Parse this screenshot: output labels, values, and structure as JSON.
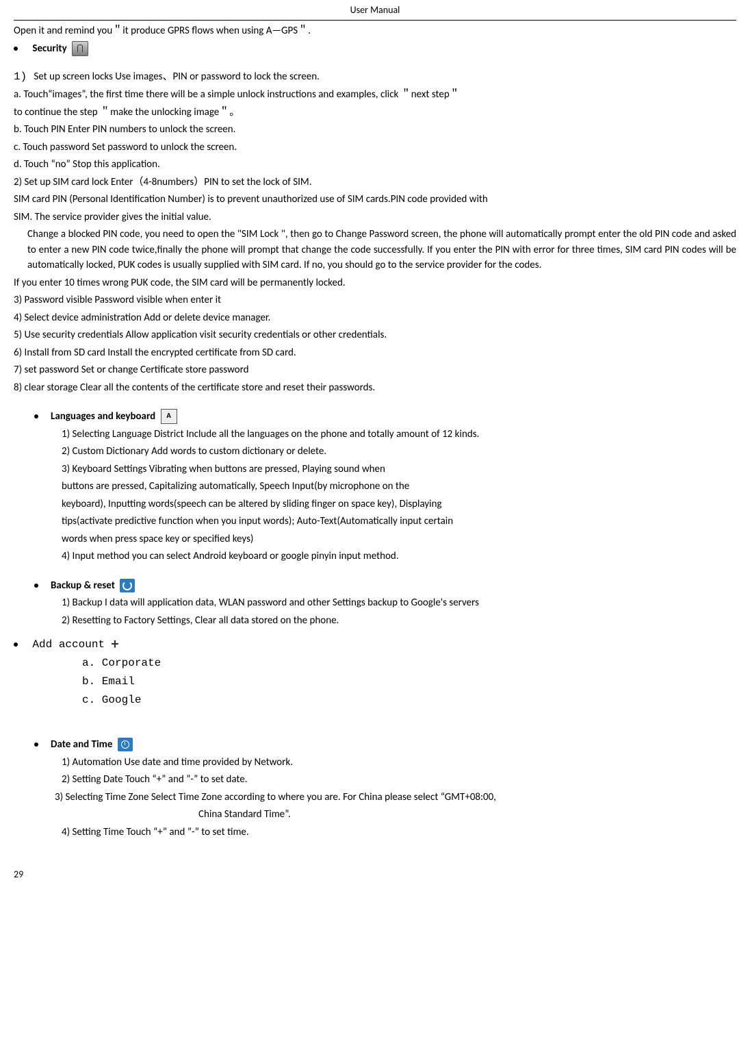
{
  "header_title": "User    Manual",
  "intro_line": "Open it and remind you＂it produce GPRS flows when using A—GPS＂.",
  "security_title": "Security",
  "security_item1_prefix": "1)",
  "security_item1": "Set up screen locks      Use images、PIN or password to lock the screen.",
  "security_a": "a. Touch“images”,    the first time there will be a simple unlock instructions and examples, click ＂next step＂",
  "security_a_cont": "to continue the step ＂make the unlocking image＂。",
  "security_b": "b. Touch PIN Enter PIN numbers to unlock the screen.",
  "security_c": "c. Touch password      Set password to unlock the screen.",
  "security_d": "d. Touch “no”      Stop this application.",
  "security_item2": "2)    Set up SIM card lock      Enter（4-8numbers）PIN to set the lock of SIM.",
  "sim_para1": "SIM card PIN (Personal Identification Number) is to prevent unauthorized use of SIM cards.PIN code provided with",
  "sim_para1b": "SIM. The service provider gives the initial value.",
  "sim_para2": "Change a blocked PIN code, you need to open the \"SIM Lock \", then go to Change Password screen, the phone will automatically prompt enter the old PIN code and asked to enter a new PIN code twice,finally the phone will prompt that change the code successfully. If you enter the PIN with error for three times, SIM card PIN codes will be automatically locked, PUK codes is usually supplied with SIM card. If no, you should go to the service provider for the codes.",
  "sim_para3": "If you enter 10 times wrong PUK code, the SIM card will be permanently locked.",
  "security_item3": "3)    Password visible        Password visible when enter it",
  "security_item4": "4)    Select device administration      Add or delete device manager.",
  "security_item5": "5)    Use security credentials        Allow application visit security credentials or other credentials.",
  "security_item6": "6)    Install from SD card      Install the encrypted certificate from SD card.",
  "security_item7": "7)    set password        Set or change Certificate store password",
  "security_item8": "8)    clear storage        Clear all the contents of the certificate store and reset their passwords.",
  "lang_title": "Languages and keyboard",
  "lang_icon_text": "A",
  "lang_1": "1) Selecting Language District        Include all the languages on the phone and totally amount of 12 kinds.",
  "lang_2": "2) Custom Dictionary          Add words to custom dictionary or delete.",
  "lang_3a": "3) Keyboard Settings        Vibrating when buttons are pressed, Playing sound when",
  "lang_3b": "buttons are pressed, Capitalizing automatically, Speech Input(by microphone on the",
  "lang_3c": "keyboard), Inputting words(speech can be altered by sliding finger on space key), Displaying",
  "lang_3d": "tips(activate predictive function when you input words); Auto-Text(Automatically input certain",
  "lang_3e": "words when press space key or specified keys)",
  "lang_4": "4) Input method        you can select Android keyboard or google pinyin input method.",
  "backup_title": "Backup & reset",
  "backup_1": "1)    Backup I  data will application data, WLAN password and other Settings backup to Google's servers",
  "backup_2": "2)    Resetting to Factory Settings, Clear all data stored on the phone.",
  "add_account_title": "Add account",
  "add_a": "a.  Corporate",
  "add_b": "b.  Email",
  "add_c": "c.  Google",
  "date_title": "Date and Time",
  "date_1": "1) Automation        Use date and time provided by Network.",
  "date_2": "2) Setting Date        Touch “+” and ”-” to set date.",
  "date_3a": "3) Selecting Time Zone       Select Time Zone according to where you are. For China please select “GMT+08:00,",
  "date_3b": "China Standard Time”.",
  "date_4": "4) Setting Time        Touch “+” and ”-” to set time.",
  "page_number": "29"
}
